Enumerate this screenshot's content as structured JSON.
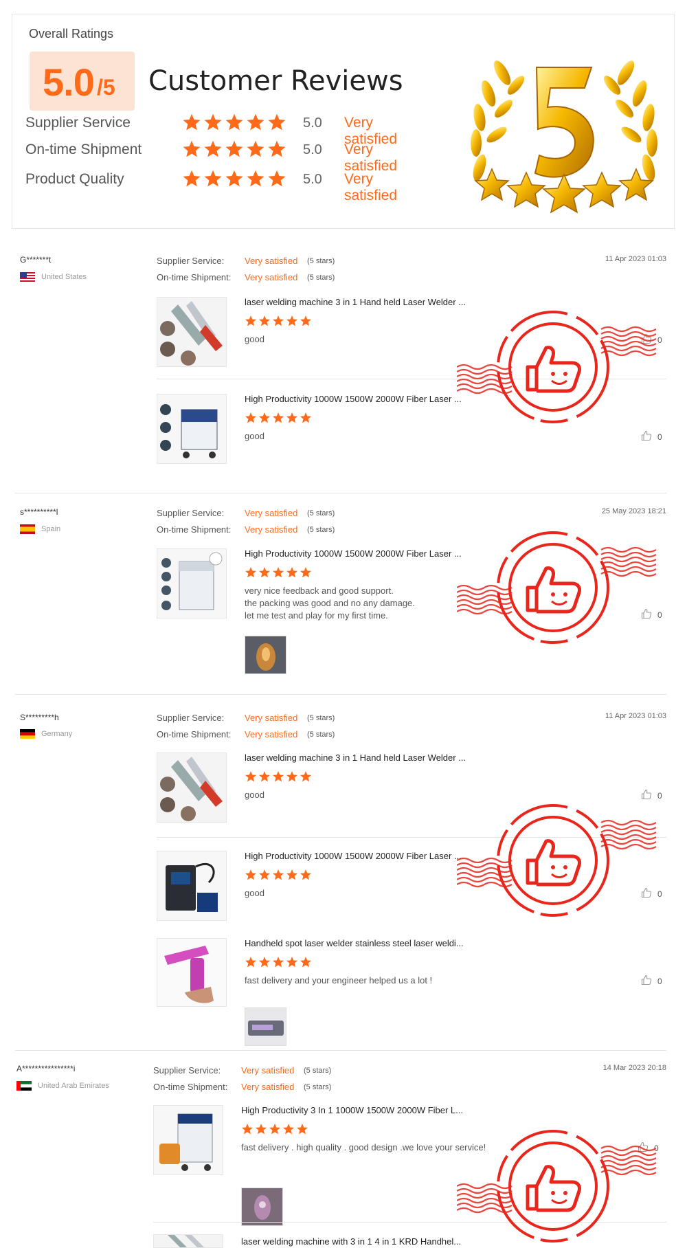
{
  "summary": {
    "overall_label": "Overall Ratings",
    "score": "5.0",
    "score_den": "/5",
    "heading": "Customer Reviews",
    "rows": [
      {
        "label": "Supplier Service",
        "score": "5.0",
        "text": "Very satisfied"
      },
      {
        "label": "On-time Shipment",
        "score": "5.0",
        "text": "Very satisfied"
      },
      {
        "label": "Product Quality",
        "score": "5.0",
        "text": "Very satisfied"
      }
    ],
    "rating_stars": 5,
    "trophy_icon": "gold-number-5-laurel-trophy-icon"
  },
  "review_labels": {
    "supplier": "Supplier Service:",
    "shipment": "On-time Shipment:",
    "value": "Very satisfied",
    "count": "(5 stars)"
  },
  "reviews": [
    {
      "buyer": "G*******t",
      "country": "United States",
      "date": "11 Apr 2023 01:03",
      "items": [
        {
          "title": "laser welding machine 3 in 1 Hand held Laser Welder ...",
          "text": "good",
          "likes": "0"
        },
        {
          "title": "High Productivity 1000W 1500W 2000W Fiber Laser ...",
          "text": "good",
          "likes": "0"
        }
      ]
    },
    {
      "buyer": "s**********l",
      "country": "Spain",
      "date": "25 May 2023 18:21",
      "items": [
        {
          "title": "High Productivity 1000W 1500W 2000W Fiber Laser ...",
          "text_lines": [
            "very nice feedback and good support.",
            "the packing was good and no any damage.",
            "let me test and play for my first time."
          ],
          "likes": "0"
        }
      ]
    },
    {
      "buyer": "S*********h",
      "country": "Germany",
      "date": "11 Apr 2023 01:03",
      "items": [
        {
          "title": "laser welding machine 3 in 1 Hand held Laser Welder ...",
          "text": "good",
          "likes": "0"
        },
        {
          "title": "High Productivity 1000W 1500W 2000W Fiber Laser ...",
          "text": "good",
          "likes": "0"
        },
        {
          "title": "Handheld spot laser welder stainless steel laser weldi...",
          "text": "fast delivery and your engineer  helped  us a lot !",
          "likes": "0"
        }
      ]
    },
    {
      "buyer": "A****************i",
      "country": "United Arab Emirates",
      "date": "14 Mar 2023 20:18",
      "items": [
        {
          "title": "High Productivity 3 In 1 1000W 1500W 2000W Fiber L...",
          "text": "fast delivery . high quality . good design .we love your service!",
          "likes": "0"
        },
        {
          "title": "laser welding machine with 3 in 1 4 in 1 KRD Handhel..."
        }
      ]
    }
  ],
  "colors": {
    "accent": "#ff6a1a",
    "stamp": "#e8261c",
    "score_bg": "#fde3d3"
  },
  "icons": {
    "like": "thumbs-up-icon",
    "stamp": "thumbs-up-approval-stamp-icon",
    "star": "star-icon"
  }
}
